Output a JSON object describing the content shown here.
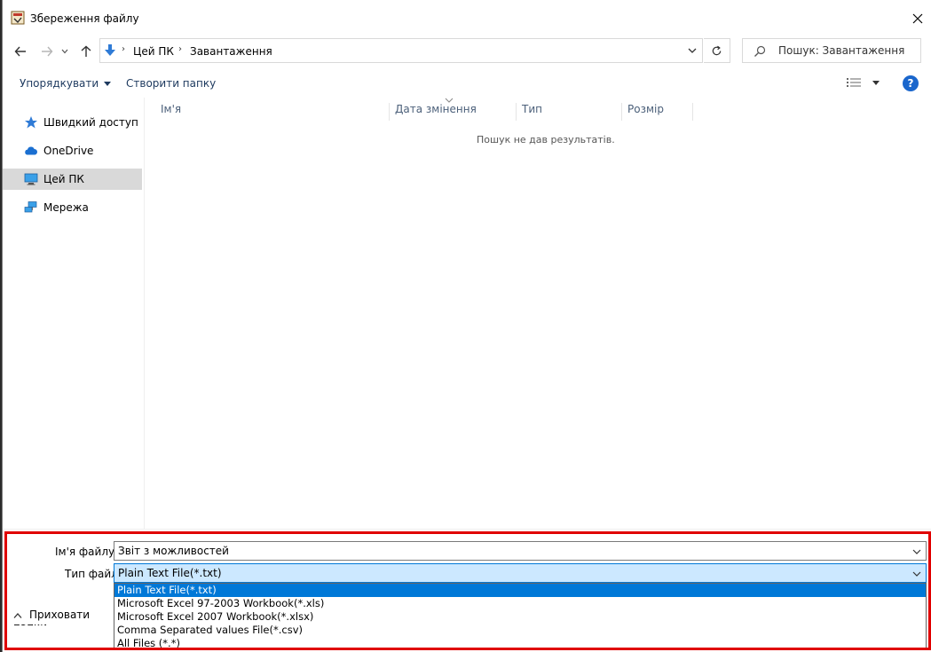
{
  "window": {
    "title": "Збереження файлу"
  },
  "address": {
    "crumbs": [
      "Цей ПК",
      "Завантаження"
    ],
    "search_placeholder": "Пошук: Завантаження"
  },
  "toolbar": {
    "organize_label": "Упорядкувати",
    "new_folder_label": "Створити папку",
    "help_label": "?"
  },
  "navpane": {
    "items": [
      {
        "label": "Швидкий доступ",
        "icon": "star-icon"
      },
      {
        "label": "OneDrive",
        "icon": "cloud-icon"
      },
      {
        "label": "Цей ПК",
        "icon": "computer-icon",
        "selected": true
      },
      {
        "label": "Мережа",
        "icon": "network-icon"
      }
    ]
  },
  "filelist": {
    "columns": [
      "Ім'я",
      "Дата змінення",
      "Тип",
      "Розмір"
    ],
    "empty_message": "Пошук не дав результатів."
  },
  "save_panel": {
    "filename_label": "Ім'я файлу:",
    "filename_value": "Звіт з можливостей",
    "filetype_label": "Тип файлу:",
    "filetype_value": "Plain Text File(*.txt)",
    "filetype_options": [
      "Plain Text File(*.txt)",
      "Microsoft Excel 97-2003 Workbook(*.xls)",
      "Microsoft Excel 2007 Workbook(*.xlsx)",
      "Comma Separated values File(*.csv)",
      "All Files (*.*)"
    ],
    "hide_folders_label": "Приховати папки"
  },
  "colors": {
    "accent": "#0078d7",
    "highlight_frame": "#e00000",
    "nav_selected": "#d9d9d9"
  }
}
